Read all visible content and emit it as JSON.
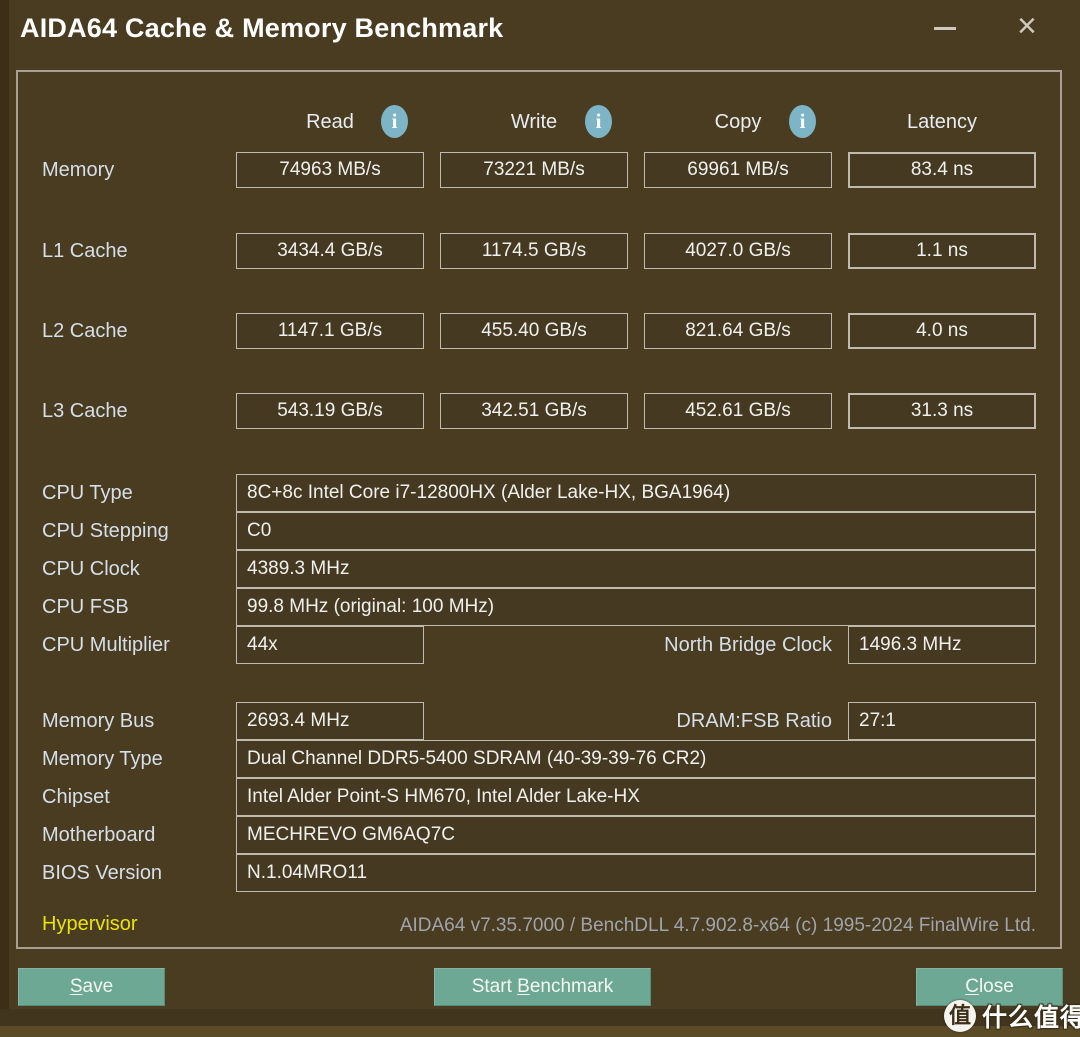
{
  "window": {
    "title": "AIDA64 Cache & Memory Benchmark",
    "close_icon": "×"
  },
  "benchmark": {
    "info_char": "i",
    "columns": [
      {
        "label": "Read",
        "has_info": true
      },
      {
        "label": "Write",
        "has_info": true
      },
      {
        "label": "Copy",
        "has_info": true
      },
      {
        "label": "Latency",
        "has_info": false
      }
    ],
    "rows": [
      {
        "label": "Memory",
        "read": "74963 MB/s",
        "write": "73221 MB/s",
        "copy": "69961 MB/s",
        "latency": "83.4 ns"
      },
      {
        "label": "L1 Cache",
        "read": "3434.4 GB/s",
        "write": "1174.5 GB/s",
        "copy": "4027.0 GB/s",
        "latency": "1.1 ns"
      },
      {
        "label": "L2 Cache",
        "read": "1147.1 GB/s",
        "write": "455.40 GB/s",
        "copy": "821.64 GB/s",
        "latency": "4.0 ns"
      },
      {
        "label": "L3 Cache",
        "read": "543.19 GB/s",
        "write": "342.51 GB/s",
        "copy": "452.61 GB/s",
        "latency": "31.3 ns"
      }
    ]
  },
  "cpu_info": [
    {
      "label": "CPU Type",
      "value": "8C+8c Intel Core i7-12800HX  (Alder Lake-HX, BGA1964)"
    },
    {
      "label": "CPU Stepping",
      "value": "C0"
    },
    {
      "label": "CPU Clock",
      "value": "4389.3 MHz"
    },
    {
      "label": "CPU FSB",
      "value": "99.8 MHz  (original: 100 MHz)"
    }
  ],
  "cpu_multiplier": {
    "label": "CPU Multiplier",
    "value": "44x",
    "right_label": "North Bridge Clock",
    "right_value": "1496.3 MHz"
  },
  "memory_bus": {
    "label": "Memory Bus",
    "value": "2693.4 MHz",
    "right_label": "DRAM:FSB Ratio",
    "right_value": "27:1"
  },
  "memory_info": [
    {
      "label": "Memory Type",
      "value": "Dual Channel DDR5-5400 SDRAM  (40-39-39-76 CR2)"
    },
    {
      "label": "Chipset",
      "value": "Intel Alder Point-S HM670, Intel Alder Lake-HX"
    },
    {
      "label": "Motherboard",
      "value": "MECHREVO GM6AQ7C"
    },
    {
      "label": "BIOS Version",
      "value": "N.1.04MRO11"
    }
  ],
  "footer": {
    "hypervisor_label": "Hypervisor",
    "version_text": "AIDA64 v7.35.7000 / BenchDLL 4.7.902.8-x64  (c) 1995-2024 FinalWire Ltd."
  },
  "buttons": {
    "save": {
      "pre": "",
      "key": "S",
      "post": "ave"
    },
    "start": {
      "pre": "Start ",
      "key": "B",
      "post": "enchmark"
    },
    "close": {
      "pre": "",
      "key": "C",
      "post": "lose"
    }
  },
  "watermark": {
    "logo_char": "值",
    "text": "什么值得买"
  },
  "colors": {
    "window_bg": "#4A3C20",
    "box_fill": "#463921",
    "box_border": "#C0BAAE",
    "button_teal": "#6CA893",
    "info_icon_teal": "#7DB5C6",
    "hypervisor_yellow": "#E9E400",
    "label_text": "#D5DFE9"
  }
}
